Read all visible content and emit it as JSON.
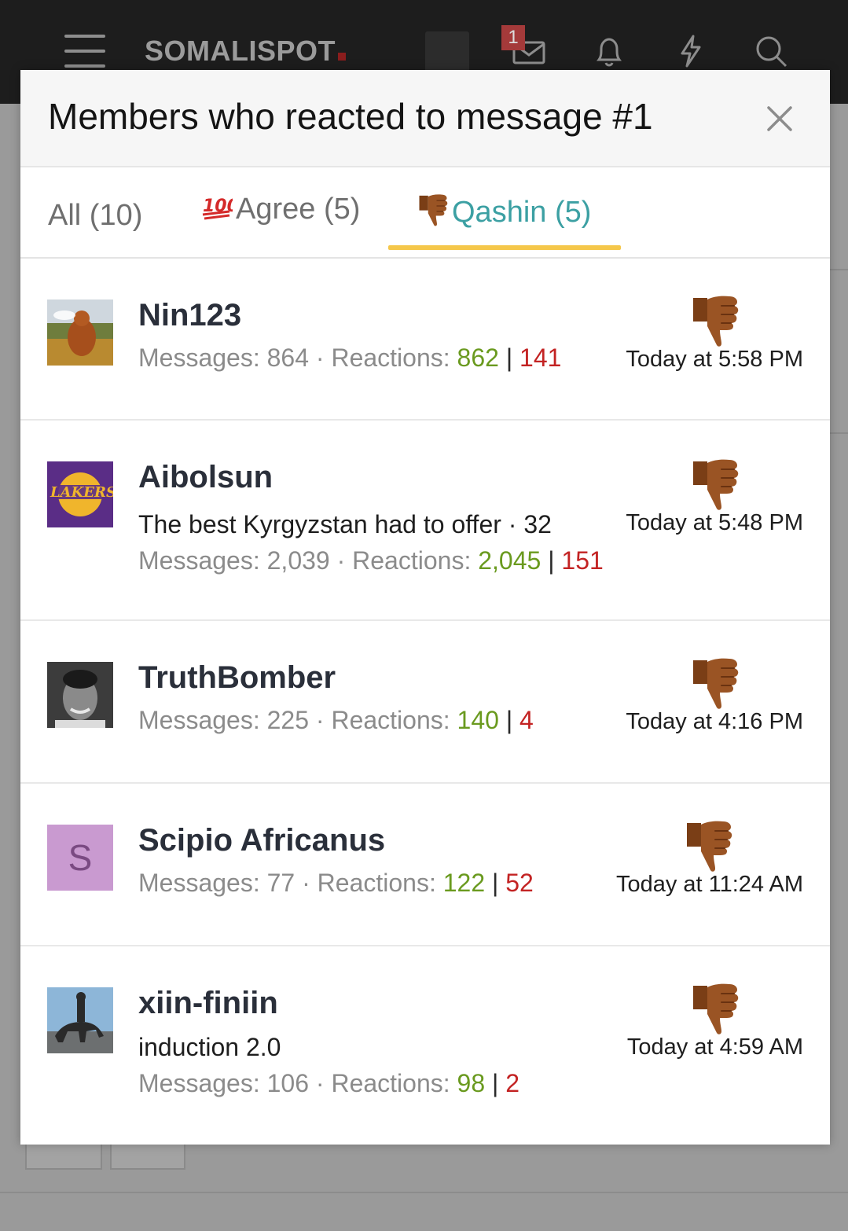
{
  "app": {
    "logo": "SOMALISPOT",
    "inbox_badge": "1"
  },
  "modal": {
    "title": "Members who reacted to message #1",
    "close_icon": "close-icon",
    "tabs": [
      {
        "label": "All (10)",
        "active": false
      },
      {
        "label": "Agree (5)",
        "icon": "hundred-points-icon",
        "active": false
      },
      {
        "label": "Qashin (5)",
        "icon": "thumbs-down-icon",
        "active": true
      }
    ]
  },
  "members": [
    {
      "username": "Nin123",
      "user_title": "",
      "messages_label": "Messages:",
      "messages": "864",
      "reactions_label": "Reactions:",
      "reactions_pos": "862",
      "reactions_neg": "141",
      "time": "Today at 5:58 PM",
      "reaction_icon": "thumbs-down-icon"
    },
    {
      "username": "Aibolsun",
      "user_title": "The best Kyrgyzstan had to offer · 32",
      "messages_label": "Messages:",
      "messages": "2,039",
      "reactions_label": "Reactions:",
      "reactions_pos": "2,045",
      "reactions_neg": "151",
      "time": "Today at 5:48 PM",
      "reaction_icon": "thumbs-down-icon"
    },
    {
      "username": "TruthBomber",
      "user_title": "",
      "messages_label": "Messages:",
      "messages": "225",
      "reactions_label": "Reactions:",
      "reactions_pos": "140",
      "reactions_neg": "4",
      "time": "Today at 4:16 PM",
      "reaction_icon": "thumbs-down-icon"
    },
    {
      "username": "Scipio Africanus",
      "avatar_letter": "S",
      "user_title": "",
      "messages_label": "Messages:",
      "messages": "77",
      "reactions_label": "Reactions:",
      "reactions_pos": "122",
      "reactions_neg": "52",
      "time": "Today at 11:24 AM",
      "reaction_icon": "thumbs-down-icon"
    },
    {
      "username": "xiin-finiin",
      "user_title": "induction 2.0",
      "messages_label": "Messages:",
      "messages": "106",
      "reactions_label": "Reactions:",
      "reactions_pos": "98",
      "reactions_neg": "2",
      "time": "Today at 4:59 AM",
      "reaction_icon": "thumbs-down-icon"
    }
  ],
  "colors": {
    "accent_tab": "#3ca0a3",
    "tab_underline": "#f5c74a",
    "positive": "#6a9a1f",
    "negative": "#c32323",
    "avatar_letter_bg": "#c99ad0"
  }
}
